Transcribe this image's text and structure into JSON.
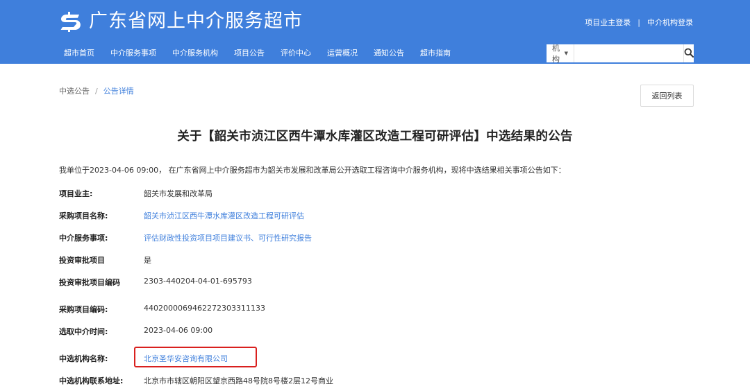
{
  "header": {
    "site_title": "广东省网上中介服务超市",
    "logo_icon": "dollar-s-logo-icon",
    "top_links": {
      "owner_login": "项目业主登录",
      "separator": "|",
      "agency_login": "中介机构登录"
    },
    "nav_items": [
      "超市首页",
      "中介服务事项",
      "中介服务机构",
      "项目公告",
      "评价中心",
      "运营概况",
      "通知公告",
      "超市指南"
    ],
    "search": {
      "select_value": "机构",
      "placeholder": "",
      "icon": "search-icon"
    },
    "colors": {
      "brand": "#3f7fdc"
    }
  },
  "breadcrumb": {
    "items": [
      "中选公告",
      "公告详情"
    ],
    "separator": "/"
  },
  "back_button_label": "返回列表",
  "title": "关于【韶关市浈江区西牛潭水库灌区改造工程可研评估】中选结果的公告",
  "intro": "我单位于2023-04-06 09:00， 在广东省网上中介服务超市为韶关市发展和改革局公开选取工程咨询中介服务机构，现将中选结果相关事项公告如下：",
  "fields": [
    {
      "label": "项目业主:",
      "value": "韶关市发展和改革局"
    },
    {
      "label": "采购项目名称:",
      "value": "韶关市浈江区西牛潭水库灌区改造工程可研评估"
    },
    {
      "label": "中介服务事项:",
      "value": "评估财政性投资项目项目建议书、可行性研究报告"
    },
    {
      "label": "投资审批项目",
      "value": "是"
    },
    {
      "label": "投资审批项目编码",
      "value": "2303-440204-04-01-695793"
    },
    {
      "label": "采购项目编码:",
      "value": "440200006946227230331113​3"
    },
    {
      "label": "选取中介时间:",
      "value": "2023-04-06 09:00"
    },
    {
      "label": "中选机构名称:",
      "value": "北京圣华安咨询有限公司"
    },
    {
      "label": "中选机构联系地址:",
      "value": "北京市市辖区朝阳区望京西路48号院8号楼2层12号商业"
    }
  ],
  "highlight_color": "#d9201e"
}
